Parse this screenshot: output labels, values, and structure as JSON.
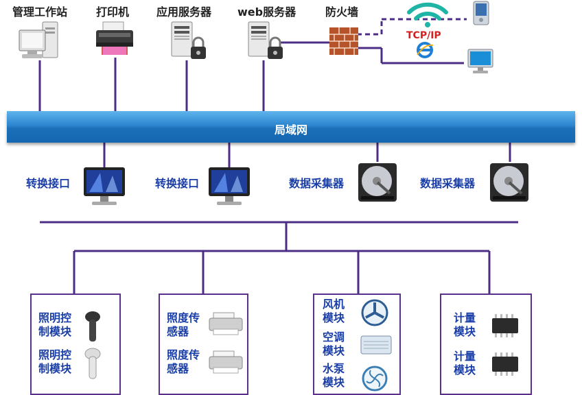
{
  "top_devices": [
    {
      "label": "管理工作站",
      "icon": "workstation-icon"
    },
    {
      "label": "打印机",
      "icon": "printer-icon"
    },
    {
      "label": "应用服务器",
      "icon": "server-lock-icon"
    },
    {
      "label": "web服务器",
      "icon": "server-lock-icon"
    },
    {
      "label": "防火墙",
      "icon": "firewall-icon"
    }
  ],
  "external": {
    "protocol": "TCP/IP",
    "icons": [
      "wifi-icon",
      "ie-icon",
      "pda-icon",
      "monitor-icon"
    ]
  },
  "lan_label": "局域网",
  "middle_devices": [
    {
      "label": "转换接口",
      "icon": "monitor-icon"
    },
    {
      "label": "转换接口",
      "icon": "monitor-icon"
    },
    {
      "label": "数据采集器",
      "icon": "hard-disk-icon"
    },
    {
      "label": "数据采集器",
      "icon": "hard-disk-icon"
    }
  ],
  "modules": {
    "lighting": [
      "照明控制模块",
      "照明控制模块"
    ],
    "illuminance": [
      "照度传感器",
      "照度传感器"
    ],
    "hvac": [
      "风机模块",
      "空调模块",
      "水泵模块"
    ],
    "metering": [
      "计量模块",
      "计量模块"
    ]
  },
  "colors": {
    "line": "#4b2d86",
    "lan": "#2c86cf",
    "label_blue": "#1a3ea8",
    "box_border": "#5b2f8c"
  }
}
